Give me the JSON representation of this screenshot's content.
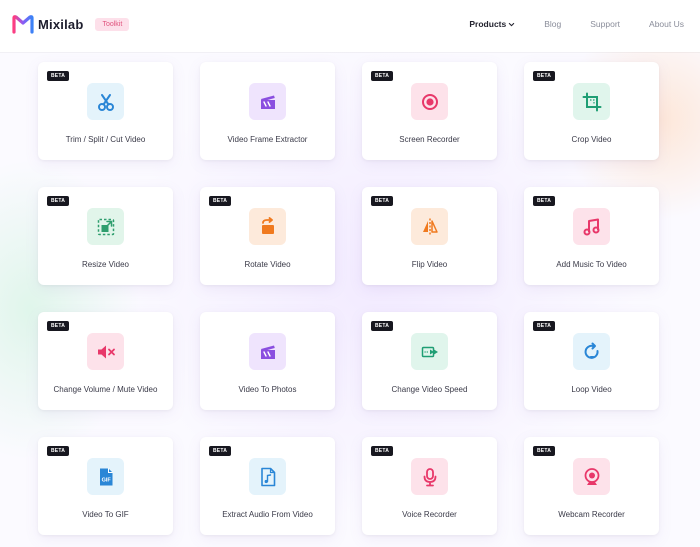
{
  "header": {
    "brand": "Mixilab",
    "badge": "Toolkit",
    "nav": {
      "products": "Products",
      "blog": "Blog",
      "support": "Support",
      "about": "About Us"
    }
  },
  "tools": [
    {
      "label": "Trim / Split / Cut Video",
      "beta": "BETA",
      "icon": "scissors-icon",
      "color": "#2a86d6",
      "bg": "#e4f3fb"
    },
    {
      "label": "Video Frame Extractor",
      "beta": "",
      "icon": "clapperboard-icon",
      "color": "#8a4fe0",
      "bg": "#efe4fd"
    },
    {
      "label": "Screen Recorder",
      "beta": "BETA",
      "icon": "record-icon",
      "color": "#e8386a",
      "bg": "#fde2ea"
    },
    {
      "label": "Crop Video",
      "beta": "BETA",
      "icon": "crop-icon",
      "color": "#1f9e74",
      "bg": "#e0f5ec"
    },
    {
      "label": "Resize Video",
      "beta": "BETA",
      "icon": "resize-icon",
      "color": "#2f9e6e",
      "bg": "#e1f5ea"
    },
    {
      "label": "Rotate Video",
      "beta": "BETA",
      "icon": "rotate-icon",
      "color": "#f07a1f",
      "bg": "#fdeadb"
    },
    {
      "label": "Flip Video",
      "beta": "BETA",
      "icon": "flip-icon",
      "color": "#f07a1f",
      "bg": "#fdeadb"
    },
    {
      "label": "Add Music To Video",
      "beta": "BETA",
      "icon": "music-note-icon",
      "color": "#e8386a",
      "bg": "#fde2ea"
    },
    {
      "label": "Change Volume / Mute Video",
      "beta": "BETA",
      "icon": "mute-icon",
      "color": "#e8386a",
      "bg": "#fde2ea"
    },
    {
      "label": "Video To Photos",
      "beta": "",
      "icon": "clapperboard-icon",
      "color": "#8a4fe0",
      "bg": "#efe4fd"
    },
    {
      "label": "Change Video Speed",
      "beta": "BETA",
      "icon": "speed-icon",
      "color": "#1f9e74",
      "bg": "#e0f5ec"
    },
    {
      "label": "Loop Video",
      "beta": "BETA",
      "icon": "loop-icon",
      "color": "#2a86d6",
      "bg": "#e4f3fb"
    },
    {
      "label": "Video To GIF",
      "beta": "BETA",
      "icon": "gif-file-icon",
      "color": "#2a86d6",
      "bg": "#e4f3fb"
    },
    {
      "label": "Extract Audio From Video",
      "beta": "BETA",
      "icon": "audio-file-icon",
      "color": "#2a86d6",
      "bg": "#e4f3fb"
    },
    {
      "label": "Voice Recorder",
      "beta": "BETA",
      "icon": "microphone-icon",
      "color": "#e8386a",
      "bg": "#fde2ea"
    },
    {
      "label": "Webcam Recorder",
      "beta": "BETA",
      "icon": "webcam-icon",
      "color": "#e8386a",
      "bg": "#fde2ea"
    }
  ]
}
